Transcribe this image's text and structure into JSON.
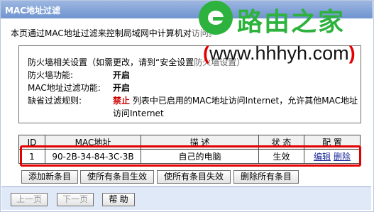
{
  "window": {
    "title": "MAC地址过滤"
  },
  "description": "本页通过MAC地址过滤来控制局域网中计算机对",
  "description_tail": "访问。",
  "firewall": {
    "hint": "防火墙相关设置（如需更改，请到“安全设置",
    "hint_tail": "防火墙设置）",
    "rows": [
      {
        "label": "防火墙功能:",
        "value": "开启"
      },
      {
        "label": "MAC地址过滤功能:",
        "value": "开启"
      }
    ],
    "default_rule_label": "缺省过滤规则:",
    "default_rule_deny": "禁止",
    "default_rule_text": "列表中已启用的MAC地址访问Internet，允许其他MAC地址",
    "default_rule_text2": "访问Internet"
  },
  "table": {
    "columns": [
      "ID",
      "MAC地址",
      "描 述",
      "状 态",
      "配 置"
    ],
    "rows": [
      {
        "id": "1",
        "mac": "90-2B-34-84-3C-3B",
        "description": "自己的电脑",
        "status": "生效",
        "edit": "编辑",
        "delete": "删除"
      }
    ]
  },
  "actions": {
    "add": "添加新条目",
    "enable_all": "使所有条目生效",
    "disable_all": "使所有条目失效",
    "delete_all": "删除所有条目"
  },
  "pager": {
    "prev": "上一页",
    "next": "下一页",
    "help": "帮 助"
  },
  "watermark": {
    "title": "路由之家",
    "url_open": "(",
    "url": "www.hhhyh.com",
    "url_close": ")"
  },
  "colors": {
    "title_bar": "#7f9fd6",
    "highlight": "#e40000",
    "deny": "#cc0000",
    "link": "#1d2d9c",
    "watermark_green": "#2db33d",
    "bottom_bar": "#dfe9f8"
  }
}
